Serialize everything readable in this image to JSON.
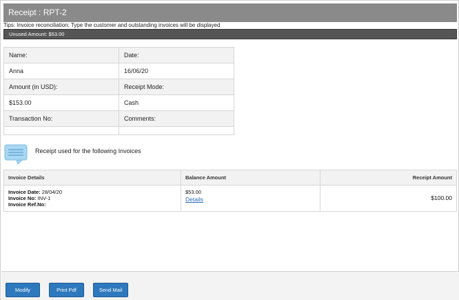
{
  "header": {
    "title": "Receipt : RPT-2",
    "tips": "Tips: Invoice reconciliation: Type the customer and outstanding invoices will be displayed",
    "unused_amount": "Unused Amount: $53.00"
  },
  "receipt_info": {
    "name_label": "Name:",
    "name_value": "Anna",
    "date_label": "Date:",
    "date_value": "16/06/20",
    "amount_label": "Amount (in USD):",
    "amount_value": "$153.00",
    "mode_label": "Receipt Mode:",
    "mode_value": "Cash",
    "transaction_label": "Transaction No:",
    "transaction_value": "",
    "comments_label": "Comments:",
    "comments_value": ""
  },
  "invoices_note": {
    "icon": "message-icon",
    "text": "Receipt used for the following Invoices"
  },
  "invoice_table": {
    "columns": [
      "Invoice Details",
      "Balance Amount",
      "Receipt Amount"
    ],
    "rows": [
      {
        "invoice_date_label": "Invoice Date:",
        "invoice_date": "28/04/20",
        "invoice_no_label": "Invoice No:",
        "invoice_no": "INV-1",
        "invoice_ref_label": "Invoice Ref.No:",
        "invoice_ref": "",
        "balance_amount": "$53.00",
        "details_link": "Details",
        "receipt_amount": "$100.00"
      }
    ]
  },
  "footer": {
    "modify_label": "Modify",
    "print_label": "Print Pdf",
    "mail_label": "Send Mail"
  },
  "colors": {
    "title_bar": "#8a8a8a",
    "unused_bar": "#555555",
    "button": "#2e79bd",
    "link": "#2a6cb5"
  }
}
